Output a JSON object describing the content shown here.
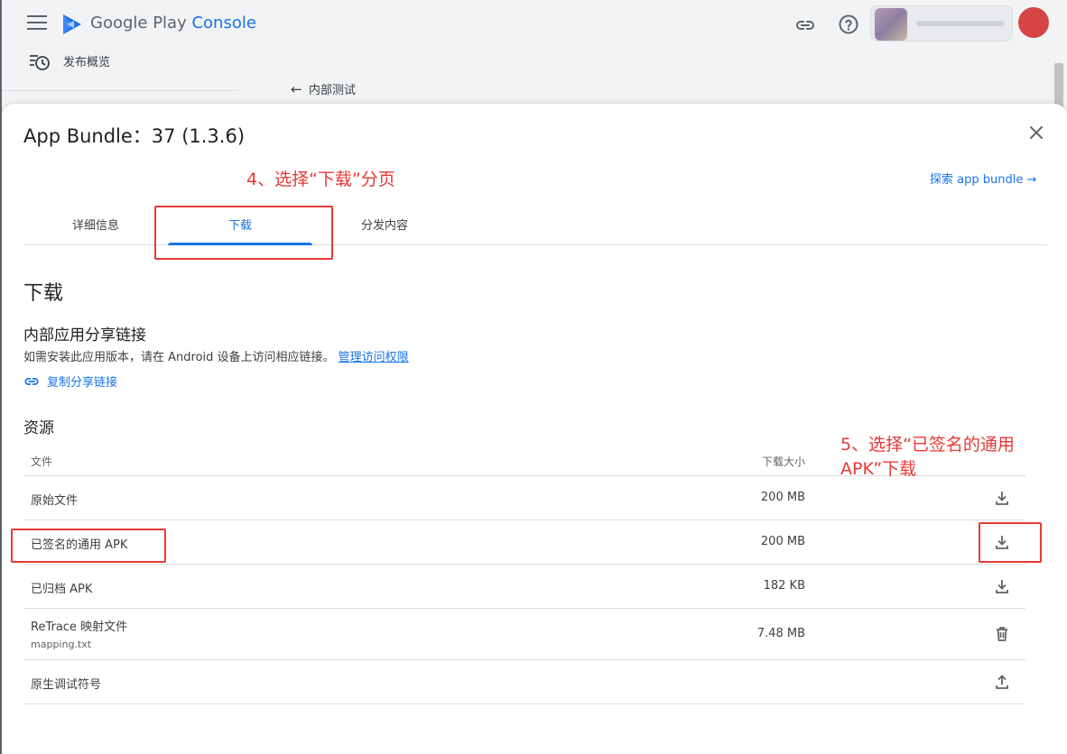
{
  "header": {
    "brand_main": "Google Play",
    "brand_accent": "Console"
  },
  "nav": {
    "release_overview": "发布概览",
    "back_label": "内部测试"
  },
  "dialog": {
    "title": "App Bundle：37 (1.3.6)",
    "explore_link": "探索 app bundle",
    "tabs": [
      {
        "label": "详细信息"
      },
      {
        "label": "下载"
      },
      {
        "label": "分发内容"
      }
    ],
    "active_tab": "下载",
    "section_title": "下载",
    "share": {
      "title": "内部应用分享链接",
      "description": "如需安装此应用版本，请在 Android 设备上访问相应链接。",
      "manage_link": "管理访问权限",
      "copy_link": "复制分享链接"
    },
    "resources": {
      "title": "资源",
      "col_file": "文件",
      "col_size": "下载大小",
      "rows": [
        {
          "name": "原始文件",
          "sub": "",
          "size": "200 MB",
          "action_icon": "download-icon"
        },
        {
          "name": "已签名的通用 APK",
          "sub": "",
          "size": "200 MB",
          "action_icon": "download-icon"
        },
        {
          "name": "已归档 APK",
          "sub": "",
          "size": "182 KB",
          "action_icon": "download-icon"
        },
        {
          "name": "ReTrace 映射文件",
          "sub": "mapping.txt",
          "size": "7.48 MB",
          "action_icon": "delete-icon"
        },
        {
          "name": "原生调试符号",
          "sub": "",
          "size": "",
          "action_icon": "upload-icon"
        }
      ]
    }
  },
  "annotations": {
    "step4": "4、选择“下载”分页",
    "step5_line1": "5、选择“已签名的通用",
    "step5_line2": "APK”下载"
  },
  "colors": {
    "accent": "#1a73e8",
    "annotation": "#e53935"
  }
}
